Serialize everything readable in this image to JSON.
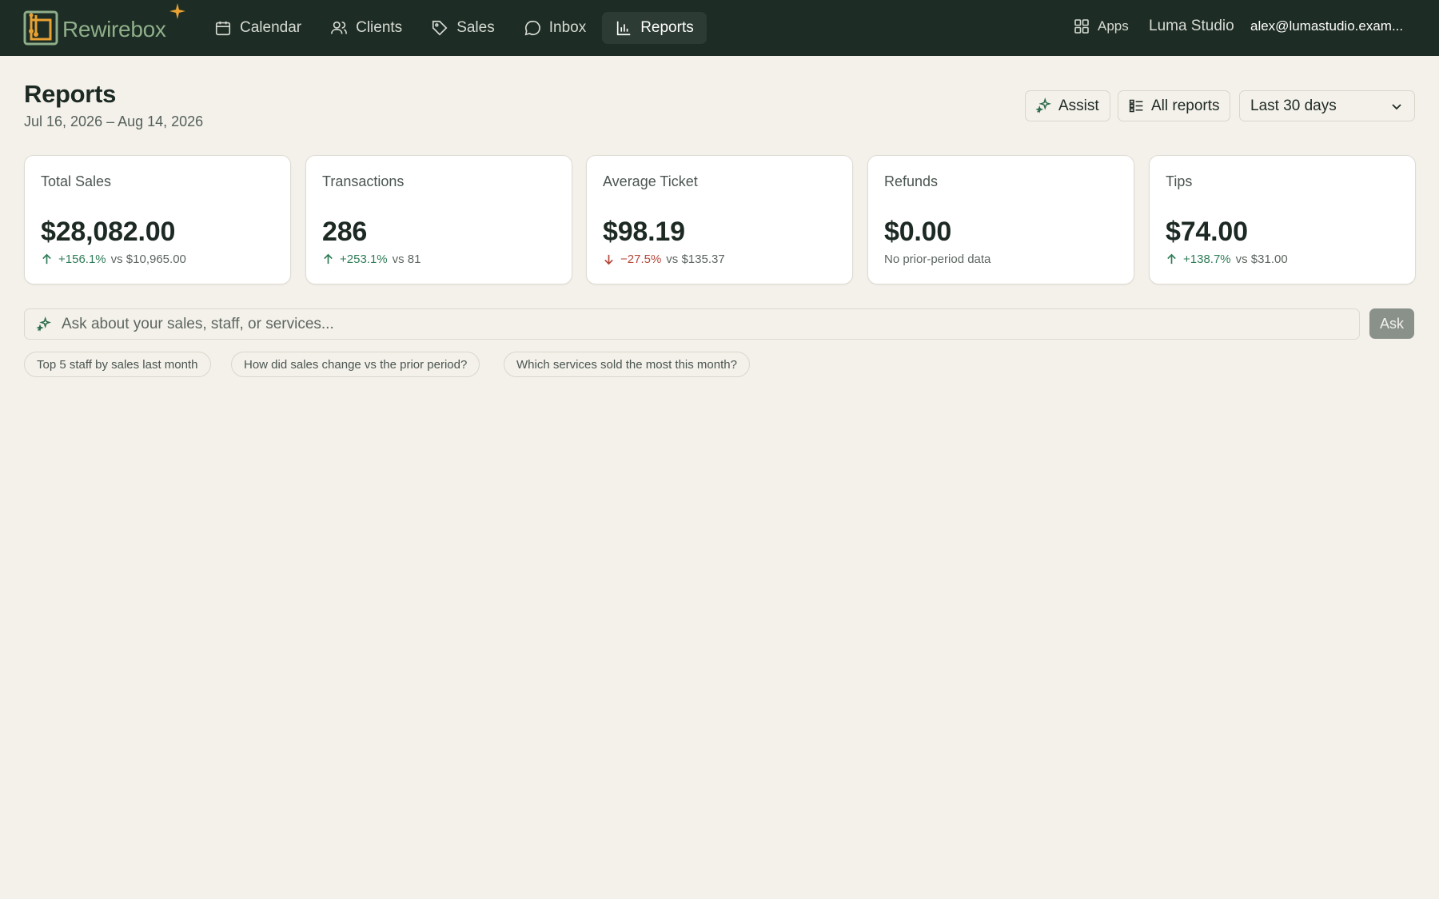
{
  "brand": {
    "name": "Rewirebox"
  },
  "nav": [
    {
      "label": "Calendar",
      "icon": "calendar-icon",
      "active": false
    },
    {
      "label": "Clients",
      "icon": "users-icon",
      "active": false
    },
    {
      "label": "Sales",
      "icon": "tag-icon",
      "active": false
    },
    {
      "label": "Inbox",
      "icon": "chat-icon",
      "active": false
    },
    {
      "label": "Reports",
      "icon": "bar-chart-icon",
      "active": true
    }
  ],
  "topbar": {
    "apps_label": "Apps",
    "studio": "Luma Studio",
    "account": "alex@lumastudio.exam..."
  },
  "header": {
    "title": "Reports",
    "date_range": "Jul 16, 2026 – Aug 14, 2026",
    "assist_label": "Assist",
    "all_reports_label": "All reports",
    "range_select": "Last 30 days"
  },
  "cards": [
    {
      "label": "Total Sales",
      "value": "$28,082.00",
      "delta": "+156.1%",
      "direction": "up",
      "compare": "vs $10,965.00"
    },
    {
      "label": "Transactions",
      "value": "286",
      "delta": "+253.1%",
      "direction": "up",
      "compare": "vs 81"
    },
    {
      "label": "Average Ticket",
      "value": "$98.19",
      "delta": "−27.5%",
      "direction": "down",
      "compare": "vs $135.37"
    },
    {
      "label": "Refunds",
      "value": "$0.00",
      "delta": "",
      "direction": "none",
      "compare": "No prior-period data"
    },
    {
      "label": "Tips",
      "value": "$74.00",
      "delta": "+138.7%",
      "direction": "up",
      "compare": "vs $31.00"
    }
  ],
  "ask": {
    "placeholder": "Ask about your sales, staff, or services...",
    "button_label": "Ask"
  },
  "suggestions": [
    "Top 5 staff by sales last month",
    "How did sales change vs the prior period?",
    "Which services sold the most this month?"
  ],
  "colors": {
    "topbar": "#1d2c24",
    "background": "#f3f1ea",
    "positive": "#2f7d58",
    "negative": "#b6483a",
    "brand_accent": "#e8a233"
  }
}
